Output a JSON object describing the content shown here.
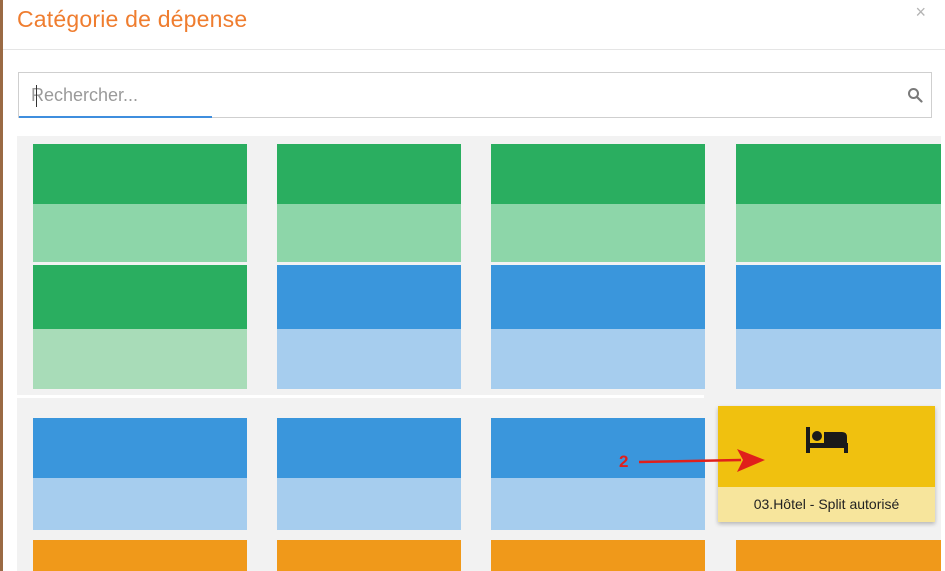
{
  "dialog": {
    "title": "Catégorie de dépense",
    "close_glyph": "×"
  },
  "search": {
    "placeholder": "Rechercher...",
    "icon": "search-icon"
  },
  "highlighted_category": {
    "label": "03.Hôtel - Split autorisé",
    "icon": "bed-icon",
    "color": "#f0c10f"
  },
  "annotation": {
    "step_number": "2",
    "color": "#e0201b"
  },
  "tile_colors": {
    "green": "#2aae60",
    "blue": "#3a96dc",
    "orange": "#f0991a",
    "yellow": "#f0c10f"
  }
}
